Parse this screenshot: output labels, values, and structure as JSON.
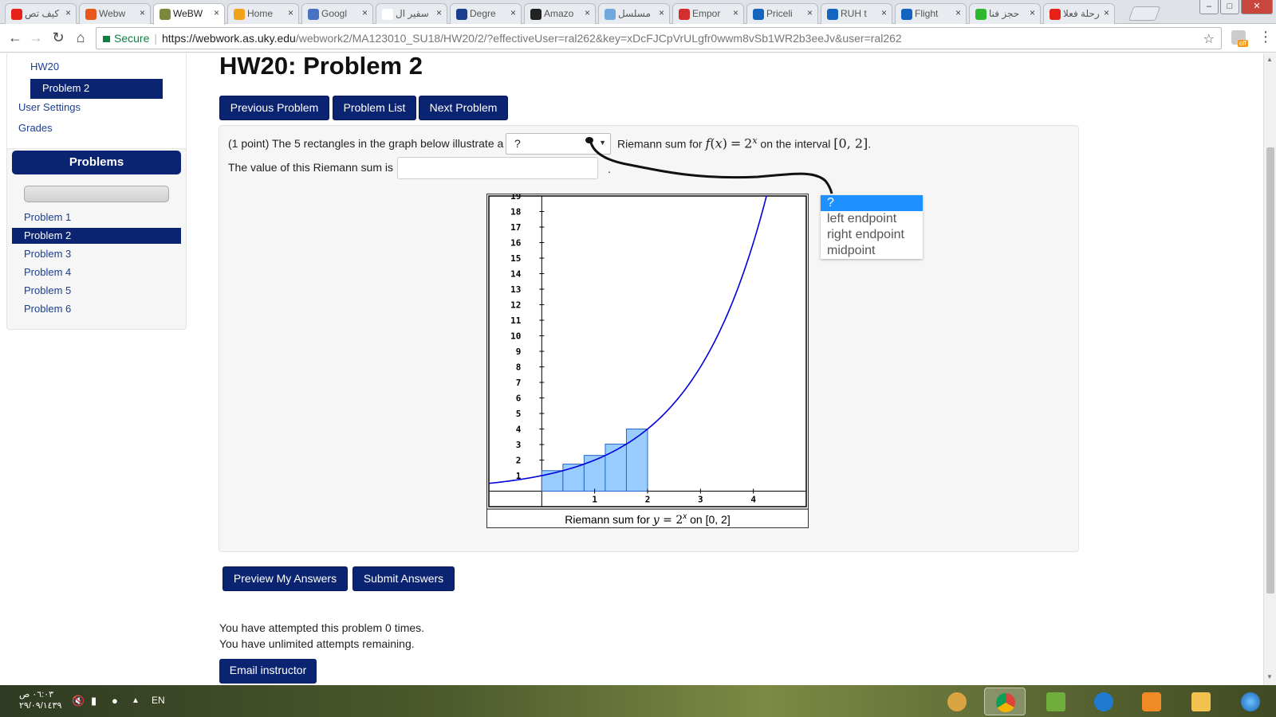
{
  "browser": {
    "tabs": [
      {
        "title": "كيف تص",
        "color": "#e62117"
      },
      {
        "title": "Webw",
        "color": "#e8581c"
      },
      {
        "title": "WeBW",
        "color": "#7a8a3a",
        "active": true
      },
      {
        "title": "Home",
        "color": "#f0a21a"
      },
      {
        "title": "Googl",
        "color": "#4a72c4"
      },
      {
        "title": "سفير ال",
        "color": "#ffffff"
      },
      {
        "title": "Degre",
        "color": "#1b3e8f"
      },
      {
        "title": "Amazo",
        "color": "#222222"
      },
      {
        "title": "مسلسل",
        "color": "#6fa8dc"
      },
      {
        "title": "Empor",
        "color": "#d32f2f"
      },
      {
        "title": "Priceli",
        "color": "#1565c0"
      },
      {
        "title": "RUH t",
        "color": "#1565c0"
      },
      {
        "title": "Flight",
        "color": "#1565c0"
      },
      {
        "title": "حجز فنا",
        "color": "#2eb82e"
      },
      {
        "title": "رحلة فعلا",
        "color": "#e62117"
      }
    ],
    "close_glyph": "×",
    "address": {
      "secure_label": "Secure",
      "url_host": "https://webwork.as.uky.edu",
      "url_path": "/webwork2/MA123010_SU18/HW20/2/?effectiveUser=ral262&key=xDcFJCpVrULgfr0wwm8vSb1WR2b3eeJv&user=ral262"
    },
    "extension_badge": "off"
  },
  "sidebar": {
    "nav": {
      "hw_link": "HW20",
      "problem_active": "Problem 2",
      "user_settings": "User Settings",
      "grades": "Grades"
    },
    "problems_heading": "Problems",
    "problems": [
      "Problem 1",
      "Problem 2",
      "Problem 3",
      "Problem 4",
      "Problem 5",
      "Problem 6"
    ],
    "active_index": 1
  },
  "main": {
    "title": "HW20: Problem 2",
    "nav_buttons": {
      "previous": "Previous Problem",
      "list": "Problem List",
      "next": "Next Problem"
    },
    "problem": {
      "intro": "(1 point) The 5 rectangles in the graph below illustrate a",
      "select_value": "?",
      "after_select": "Riemann sum for",
      "f_name": "f",
      "var": "x",
      "equals": "=",
      "base": "2",
      "exponent": "x",
      "interval_label": "on the interval",
      "interval": "[0, 2]",
      "period": ".",
      "value_label": "The value of this Riemann sum is",
      "value_input": "",
      "value_period": "."
    },
    "dropdown_options": [
      "?",
      "left endpoint",
      "right endpoint",
      "midpoint"
    ],
    "dropdown_selected": 0,
    "graph": {
      "caption_prefix": "Riemann sum for",
      "caption_var": "y",
      "caption_equals": "=",
      "caption_base": "2",
      "caption_exp": "x",
      "caption_on": "on",
      "caption_interval": "[0, 2]",
      "curve_color": "#0000dd",
      "rect_fill": "#99ccff",
      "rect_stroke": "#2266cc"
    },
    "actions": {
      "preview": "Preview My Answers",
      "submit": "Submit Answers"
    },
    "attempts": {
      "line1": "You have attempted this problem 0 times.",
      "line2": "You have unlimited attempts remaining."
    },
    "email_button": "Email instructor"
  },
  "chart_data": {
    "type": "area",
    "title": "Riemann sum for y = 2^x on [0, 2]",
    "function": "2^x",
    "interval": [
      0,
      2
    ],
    "rectangles": [
      {
        "x_start": 0.0,
        "x_end": 0.4,
        "height": 1.32
      },
      {
        "x_start": 0.4,
        "x_end": 0.8,
        "height": 1.74
      },
      {
        "x_start": 0.8,
        "x_end": 1.2,
        "height": 2.3
      },
      {
        "x_start": 1.2,
        "x_end": 1.6,
        "height": 3.03
      },
      {
        "x_start": 1.6,
        "x_end": 2.0,
        "height": 4.0
      }
    ],
    "x_ticks": [
      1,
      2,
      3,
      4
    ],
    "y_ticks": [
      1,
      2,
      3,
      4,
      5,
      6,
      7,
      8,
      9,
      10,
      11,
      12,
      13,
      14,
      15,
      16,
      17,
      18,
      19
    ],
    "xlim": [
      -1,
      5
    ],
    "ylim": [
      -1,
      19
    ],
    "grid": false,
    "xlabel": "",
    "ylabel": ""
  },
  "taskbar": {
    "clock_time": "٠٦:٠٣ ص",
    "clock_date": "٢٩/٠٩/١٤٣٩",
    "language": "EN"
  }
}
